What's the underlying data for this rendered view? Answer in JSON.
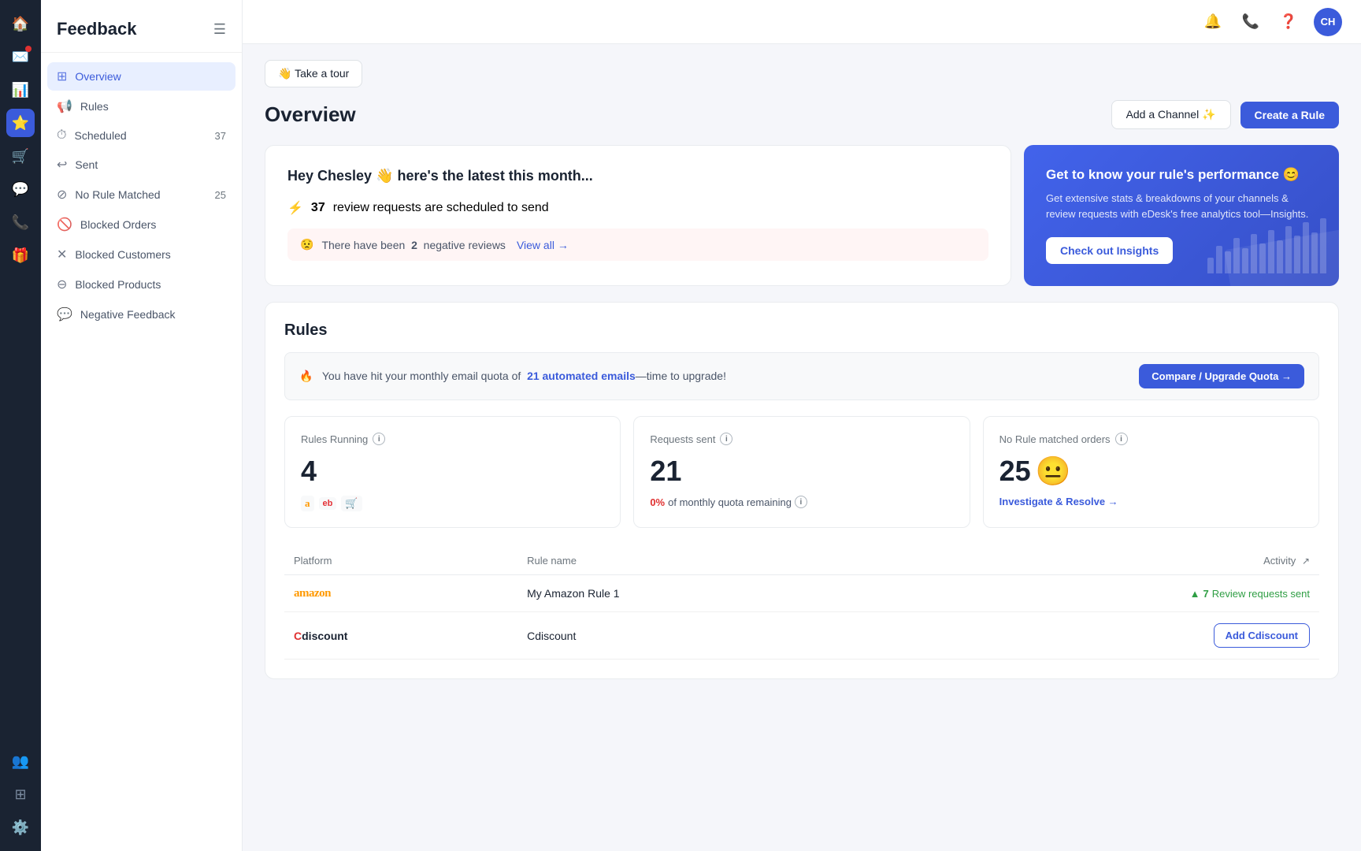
{
  "iconRail": {
    "icons": [
      "home",
      "mail",
      "chart",
      "star",
      "cart",
      "chat",
      "phone",
      "gift",
      "users",
      "grid",
      "settings"
    ]
  },
  "sidebar": {
    "title": "Feedback",
    "navItems": [
      {
        "id": "overview",
        "label": "Overview",
        "icon": "⊞",
        "active": true,
        "count": null
      },
      {
        "id": "rules",
        "label": "Rules",
        "icon": "📢",
        "active": false,
        "count": null
      },
      {
        "id": "scheduled",
        "label": "Scheduled",
        "icon": "⏰",
        "active": false,
        "count": "37"
      },
      {
        "id": "sent",
        "label": "Sent",
        "icon": "↪",
        "active": false,
        "count": null
      },
      {
        "id": "no-rule-matched",
        "label": "No Rule Matched",
        "icon": "⊘",
        "active": false,
        "count": "25"
      },
      {
        "id": "blocked-orders",
        "label": "Blocked Orders",
        "icon": "🚫",
        "active": false,
        "count": null
      },
      {
        "id": "blocked-customers",
        "label": "Blocked Customers",
        "icon": "✕",
        "active": false,
        "count": null
      },
      {
        "id": "blocked-products",
        "label": "Blocked Products",
        "icon": "⊖",
        "active": false,
        "count": null
      },
      {
        "id": "negative-feedback",
        "label": "Negative Feedback",
        "icon": "💬",
        "active": false,
        "count": null
      }
    ]
  },
  "topbar": {
    "avatarInitials": "CH",
    "avatarColor": "#3b5bdb"
  },
  "tour": {
    "buttonLabel": "👋 Take a tour"
  },
  "pageHeader": {
    "title": "Overview",
    "addChannelLabel": "Add a Channel ✨",
    "createRuleLabel": "Create a Rule"
  },
  "heyCard": {
    "greeting": "Hey Chesley 👋 here's the latest this month...",
    "scheduledCount": "37",
    "scheduledText": "review requests are scheduled to send",
    "lightning": "⚡",
    "negativeEmoji": "😟",
    "negativeText": "There have been",
    "negativeCount": "2",
    "negativeLabel": "negative reviews",
    "viewAllLabel": "View all →"
  },
  "insightsCard": {
    "emoji": "😊",
    "title": "Get to know your rule's performance 😊",
    "description": "Get extensive stats & breakdowns of your channels & review requests with eDesk's free analytics tool—Insights.",
    "buttonLabel": "Check out Insights"
  },
  "rules": {
    "sectionTitle": "Rules",
    "quotaBanner": {
      "emoji": "🔥",
      "text": "You have hit your monthly email quota of",
      "countText": "21 automated emails",
      "suffixText": "—time to upgrade!",
      "buttonLabel": "Compare / Upgrade Quota →"
    },
    "stats": [
      {
        "id": "rules-running",
        "label": "Rules Running",
        "value": "4",
        "platformIcons": [
          "a",
          "eb",
          "🛒"
        ]
      },
      {
        "id": "requests-sent",
        "label": "Requests sent",
        "value": "21",
        "quotaText": "of monthly quota remaining",
        "pctLabel": "0%"
      },
      {
        "id": "no-rule-matched",
        "label": "No Rule matched orders",
        "value": "25",
        "emoji": "😐",
        "investigateLabel": "Investigate & Resolve →"
      }
    ],
    "tableHeaders": {
      "platform": "Platform",
      "ruleName": "Rule name",
      "activity": "Activity"
    },
    "tableRows": [
      {
        "platform": "amazon",
        "platformDisplay": "amazon",
        "ruleName": "My Amazon Rule 1",
        "activityCount": "7",
        "activityLabel": "Review requests sent",
        "activityArrow": "▲"
      },
      {
        "platform": "cdiscount",
        "platformDisplay": "Cdiscount",
        "ruleName": "Cdiscount",
        "activityType": "button",
        "activityButtonLabel": "Add Cdiscount"
      }
    ]
  }
}
